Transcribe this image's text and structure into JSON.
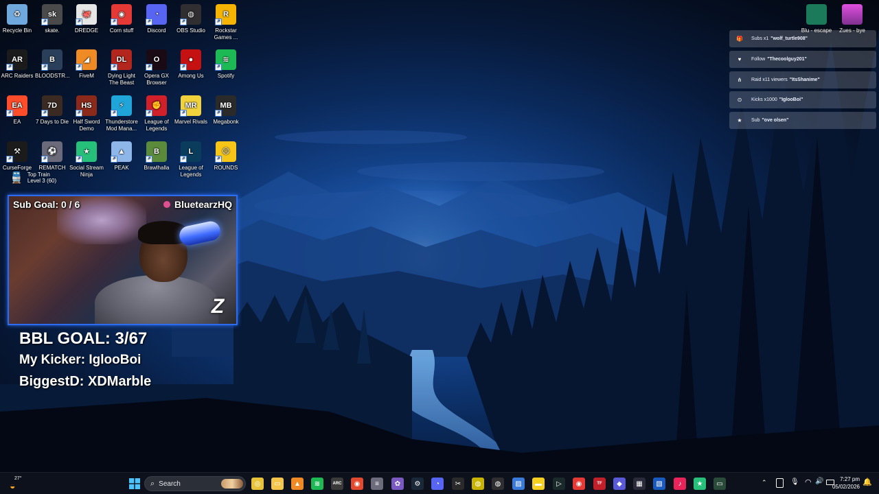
{
  "desktop_icons": [
    {
      "label": "Recycle Bin",
      "color": "#6fa8dc",
      "glyph": "♻",
      "icon": "recycle-bin-icon"
    },
    {
      "label": "skate.",
      "color": "#4a4a4a",
      "glyph": "sk",
      "icon": "skate-icon"
    },
    {
      "label": "DREDGE",
      "color": "#e6e6e6",
      "glyph": "🐙",
      "icon": "dredge-icon"
    },
    {
      "label": "Corn stuff",
      "color": "#e53935",
      "glyph": "◉",
      "icon": "corn-stuff-icon"
    },
    {
      "label": "Discord",
      "color": "#5865f2",
      "glyph": "◔",
      "icon": "discord-icon"
    },
    {
      "label": "OBS Studio",
      "color": "#302e31",
      "glyph": "◍",
      "icon": "obs-studio-icon"
    },
    {
      "label": "Rockstar Games ...",
      "color": "#f5b400",
      "glyph": "R",
      "icon": "rockstar-games-icon"
    },
    {
      "label": "ARC Raiders",
      "color": "#1b1b1b",
      "glyph": "AR",
      "icon": "arc-raiders-icon"
    },
    {
      "label": "BLOODSTR...",
      "color": "#2a3f5a",
      "glyph": "B",
      "icon": "bloodstrike-icon"
    },
    {
      "label": "FiveM",
      "color": "#f08a24",
      "glyph": "◢",
      "icon": "fivem-icon"
    },
    {
      "label": "Dying Light The Beast",
      "color": "#b3261e",
      "glyph": "DL",
      "icon": "dying-light-icon"
    },
    {
      "label": "Opera GX Browser",
      "color": "#1a0a14",
      "glyph": "O",
      "icon": "opera-gx-icon"
    },
    {
      "label": "Among Us",
      "color": "#c51111",
      "glyph": "●",
      "icon": "among-us-icon"
    },
    {
      "label": "Spotify",
      "color": "#1db954",
      "glyph": "≋",
      "icon": "spotify-icon"
    },
    {
      "label": "EA",
      "color": "#ff4c2b",
      "glyph": "EA",
      "icon": "ea-icon"
    },
    {
      "label": "7 Days to Die",
      "color": "#3a2a22",
      "glyph": "7D",
      "icon": "seven-days-icon"
    },
    {
      "label": "Half Sword Demo",
      "color": "#8b2a1a",
      "glyph": "HS",
      "icon": "half-sword-icon"
    },
    {
      "label": "Thunderstore Mod Mana...",
      "color": "#1fa5d8",
      "glyph": "⚡",
      "icon": "thunderstore-icon"
    },
    {
      "label": "League of Legends",
      "color": "#d0202a",
      "glyph": "✊",
      "icon": "riot-client-icon"
    },
    {
      "label": "Marvel Rivals",
      "color": "#f2d23c",
      "glyph": "MR",
      "icon": "marvel-rivals-icon"
    },
    {
      "label": "Megabonk",
      "color": "#2a2a2a",
      "glyph": "MB",
      "icon": "megabonk-icon"
    },
    {
      "label": "CurseForge",
      "color": "#1b1b1b",
      "glyph": "⚒",
      "icon": "curseforge-icon"
    },
    {
      "label": "REMATCH",
      "color": "#6a6a7a",
      "glyph": "⚽",
      "icon": "rematch-icon"
    },
    {
      "label": "Social Stream Ninja",
      "color": "#27c07a",
      "glyph": "★",
      "icon": "social-stream-ninja-icon"
    },
    {
      "label": "PEAK",
      "color": "#8fb6e8",
      "glyph": "▲",
      "icon": "peak-icon"
    },
    {
      "label": "Brawlhalla",
      "color": "#5a8a3a",
      "glyph": "B",
      "icon": "brawlhalla-icon"
    },
    {
      "label": "League of Legends",
      "color": "#0a3d5c",
      "glyph": "L",
      "icon": "league-of-legends-icon"
    },
    {
      "label": "ROUNDS",
      "color": "#f5c518",
      "glyph": "☹",
      "icon": "rounds-icon"
    }
  ],
  "top_right_icons": [
    {
      "label": "Blu - escape",
      "color": "#1a7a5a",
      "icon": "blu-escape-icon"
    },
    {
      "label": "Zues - bye",
      "color": "#c040c0",
      "icon": "zues-bye-icon"
    }
  ],
  "webcam": {
    "train_label": "Top Train",
    "train_level": "Level 3  (60)",
    "sub_goal": "Sub Goal:  0 / 6",
    "channel_name": "BluetearzHQ",
    "logo_glyph": "Z"
  },
  "overlay": {
    "bbl_goal": "BBL GOAL: 3/67",
    "my_kicker": "My Kicker: IglooBoi",
    "biggest_d": "BiggestD: XDMarble"
  },
  "alerts": [
    {
      "icon": "gift-icon",
      "glyph": "🎁",
      "prefix": "Subs x1",
      "name": "\"wolf_turtle908\""
    },
    {
      "icon": "heart-icon",
      "glyph": "♥",
      "prefix": "Follow",
      "name": "\"Thecoolguy201\""
    },
    {
      "icon": "raid-icon",
      "glyph": "⋔",
      "prefix": "Raid x11 viewers",
      "name": "\"ItsShanime\""
    },
    {
      "icon": "kick-icon",
      "glyph": "⊙",
      "prefix": "Kicks x1000",
      "name": "\"IglooBoi\""
    },
    {
      "icon": "star-icon",
      "glyph": "★",
      "prefix": "Sub",
      "name": "\"ove olsen\""
    }
  ],
  "taskbar": {
    "weather_temp": "27°",
    "search_label": "Search",
    "time": "7:27 pm",
    "date": "05/02/2026",
    "apps": [
      {
        "icon": "chrome-icon",
        "color": "#e8c33a",
        "glyph": "◎"
      },
      {
        "icon": "file-explorer-icon",
        "color": "#f5c44a",
        "glyph": "▭"
      },
      {
        "icon": "vlc-icon",
        "color": "#f08a24",
        "glyph": "▲"
      },
      {
        "icon": "spotify-taskbar-icon",
        "color": "#1db954",
        "glyph": "≋"
      },
      {
        "icon": "arc-icon",
        "color": "#3a3a3a",
        "glyph": "ARC"
      },
      {
        "icon": "brave-icon",
        "color": "#e2492f",
        "glyph": "◉"
      },
      {
        "icon": "notepad-icon",
        "color": "#6c6c7c",
        "glyph": "≡"
      },
      {
        "icon": "davinci-icon",
        "color": "#7a5ac0",
        "glyph": "✿"
      },
      {
        "icon": "steam-icon",
        "color": "#1b2838",
        "glyph": "⚙"
      },
      {
        "icon": "discord-taskbar-icon",
        "color": "#5865f2",
        "glyph": "◔"
      },
      {
        "icon": "capcut-icon",
        "color": "#2a2a2a",
        "glyph": "✂"
      },
      {
        "icon": "yellow-app-icon",
        "color": "#c8b400",
        "glyph": "◍"
      },
      {
        "icon": "obs-taskbar-icon",
        "color": "#302e31",
        "glyph": "◍"
      },
      {
        "icon": "photos-icon",
        "color": "#3a7ad8",
        "glyph": "▨"
      },
      {
        "icon": "sticky-notes-icon",
        "color": "#f5d020",
        "glyph": "▬"
      },
      {
        "icon": "terminal-icon",
        "color": "#1a2a2a",
        "glyph": "▷"
      },
      {
        "icon": "corn-stuff-taskbar-icon",
        "color": "#e53935",
        "glyph": "◉"
      },
      {
        "icon": "tf-icon",
        "color": "#c0202a",
        "glyph": "TF"
      },
      {
        "icon": "proton-icon",
        "color": "#5a5ad8",
        "glyph": "◆"
      },
      {
        "icon": "streamdeck-icon",
        "color": "#2a2a3a",
        "glyph": "▦"
      },
      {
        "icon": "mixer-icon",
        "color": "#1a5ac0",
        "glyph": "▧"
      },
      {
        "icon": "tiktok-icon",
        "color": "#e8245a",
        "glyph": "♪"
      },
      {
        "icon": "social-stream-taskbar-icon",
        "color": "#27c07a",
        "glyph": "★"
      },
      {
        "icon": "green-app-icon",
        "color": "#2a4a3a",
        "glyph": "▭"
      }
    ]
  }
}
